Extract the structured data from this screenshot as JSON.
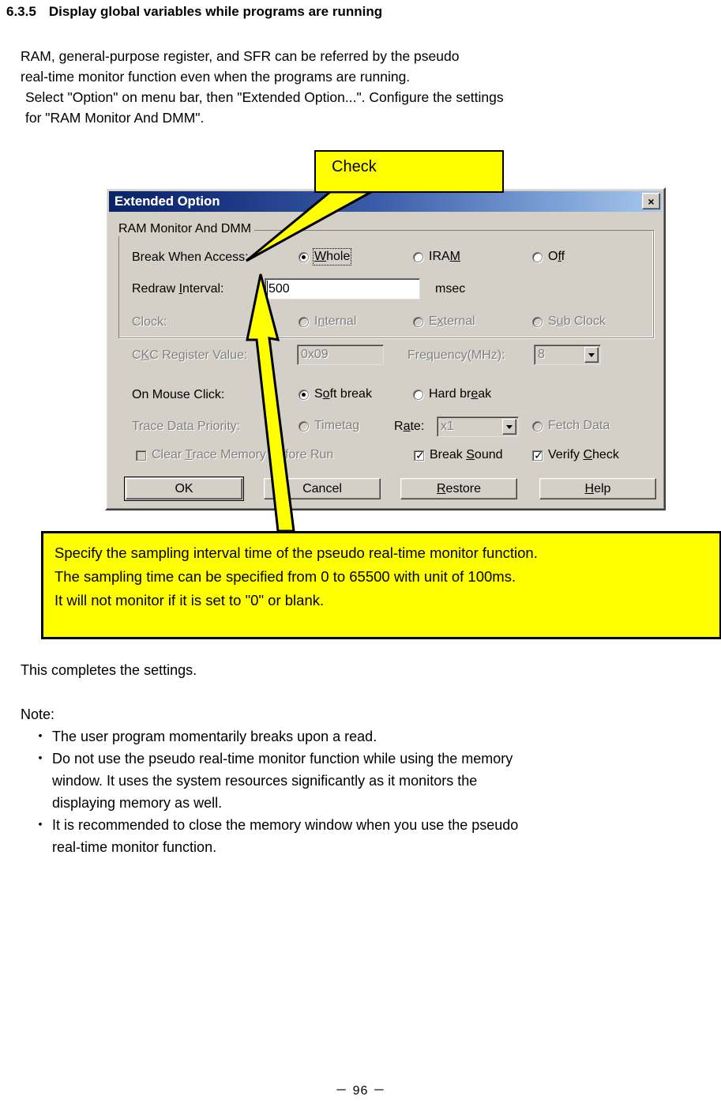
{
  "document": {
    "section_number": "6.3.5",
    "section_title": "Display global variables while programs are running",
    "intro_lines": [
      "RAM, general-purpose register, and SFR can be referred by the pseudo",
      "real-time monitor function even when the programs are running.",
      "Select \"Option\" on menu bar, then \"Extended Option...\". Configure the settings",
      "for \"RAM Monitor And DMM\"."
    ],
    "after_text": "This completes the settings.",
    "note_heading": "Note:",
    "note_bullets": [
      [
        "The user program momentarily breaks upon a read."
      ],
      [
        "Do not use the pseudo real-time monitor function while using the memory",
        "window. It uses the system resources significantly as it monitors the",
        "displaying memory as well."
      ],
      [
        "It is recommended to close the memory window when you use the pseudo",
        "real-time monitor function."
      ]
    ],
    "bullet_marker": "・",
    "page_number": "－ 96 －"
  },
  "callouts": {
    "check": {
      "label": "Check",
      "fill": "#ffff00",
      "border": "#000000"
    },
    "interval_note": {
      "lines": [
        "Specify the sampling interval time of the pseudo real-time monitor function.",
        "The sampling time can be specified from 0 to 65500 with unit of 100ms.",
        "It will not monitor if it is set to \"0\" or blank."
      ],
      "fill": "#ffff00",
      "border": "#000000"
    }
  },
  "dialog": {
    "title": "Extended Option",
    "close_icon": "×",
    "titlebar_color_start": "#0a246a",
    "titlebar_color_end": "#a6c8ee",
    "face_color": "#d4d0c8",
    "groupbox_label": "RAM Monitor And DMM",
    "rows": {
      "break_when_access": {
        "label": "Break When Access:",
        "options": [
          {
            "label_pre": "",
            "accel": "W",
            "label_post": "hole",
            "selected": true,
            "focused": true
          },
          {
            "label_pre": "IRA",
            "accel": "M",
            "label_post": "",
            "selected": false,
            "focused": false
          },
          {
            "label_pre": "O",
            "accel": "f",
            "label_post": "f",
            "selected": false,
            "focused": false
          }
        ]
      },
      "redraw_interval": {
        "label_pre": "Redraw ",
        "label_accel": "I",
        "label_post": "nterval:",
        "value": "500",
        "unit": "msec"
      },
      "clock": {
        "label": "Clock:",
        "disabled": true,
        "options": [
          {
            "label_pre": "I",
            "accel": "n",
            "label_post": "ternal"
          },
          {
            "label_pre": "E",
            "accel": "x",
            "label_post": "ternal"
          },
          {
            "label_pre": "S",
            "accel": "u",
            "label_post": "b Clock"
          }
        ]
      },
      "ckc_register": {
        "label_pre": "C",
        "label_accel": "K",
        "label_post": "C Register Value:",
        "value": "0x09",
        "disabled": true,
        "frequency_label_pre": "Fre",
        "frequency_accel": "q",
        "frequency_label_post": "uency(MHz):",
        "frequency_value": "8"
      },
      "on_mouse_click": {
        "label": "On Mouse Click:",
        "options": [
          {
            "label_pre": "S",
            "accel": "o",
            "label_post": "ft break",
            "selected": true
          },
          {
            "label_pre": "Hard br",
            "accel": "e",
            "label_post": "ak",
            "selected": false
          }
        ]
      },
      "trace_data_priority": {
        "label": "Trace Data Priority:",
        "disabled": true,
        "timetag_label": "Timetag",
        "rate_label_pre": "R",
        "rate_accel": "a",
        "rate_label_post": "te:",
        "rate_value": "x1",
        "fetch_data_label": "Fetch Data"
      },
      "clear_trace": {
        "label_pre": "Clear ",
        "accel": "T",
        "label_post": "race Memory Before Run",
        "checked": false,
        "disabled": true
      },
      "break_sound": {
        "label_pre": "Break ",
        "accel": "S",
        "label_post": "ound",
        "checked": true,
        "disabled": false
      },
      "verify_check": {
        "label_pre": "Verify ",
        "accel": "C",
        "label_post": "heck",
        "checked": true,
        "disabled": false
      }
    },
    "buttons": [
      {
        "label_pre": "OK",
        "accel": "",
        "label_post": "",
        "default": true
      },
      {
        "label_pre": "Cancel",
        "accel": "",
        "label_post": "",
        "default": false
      },
      {
        "label_pre": "",
        "accel": "R",
        "label_post": "estore",
        "default": false
      },
      {
        "label_pre": "",
        "accel": "H",
        "label_post": "elp",
        "default": false
      }
    ]
  }
}
